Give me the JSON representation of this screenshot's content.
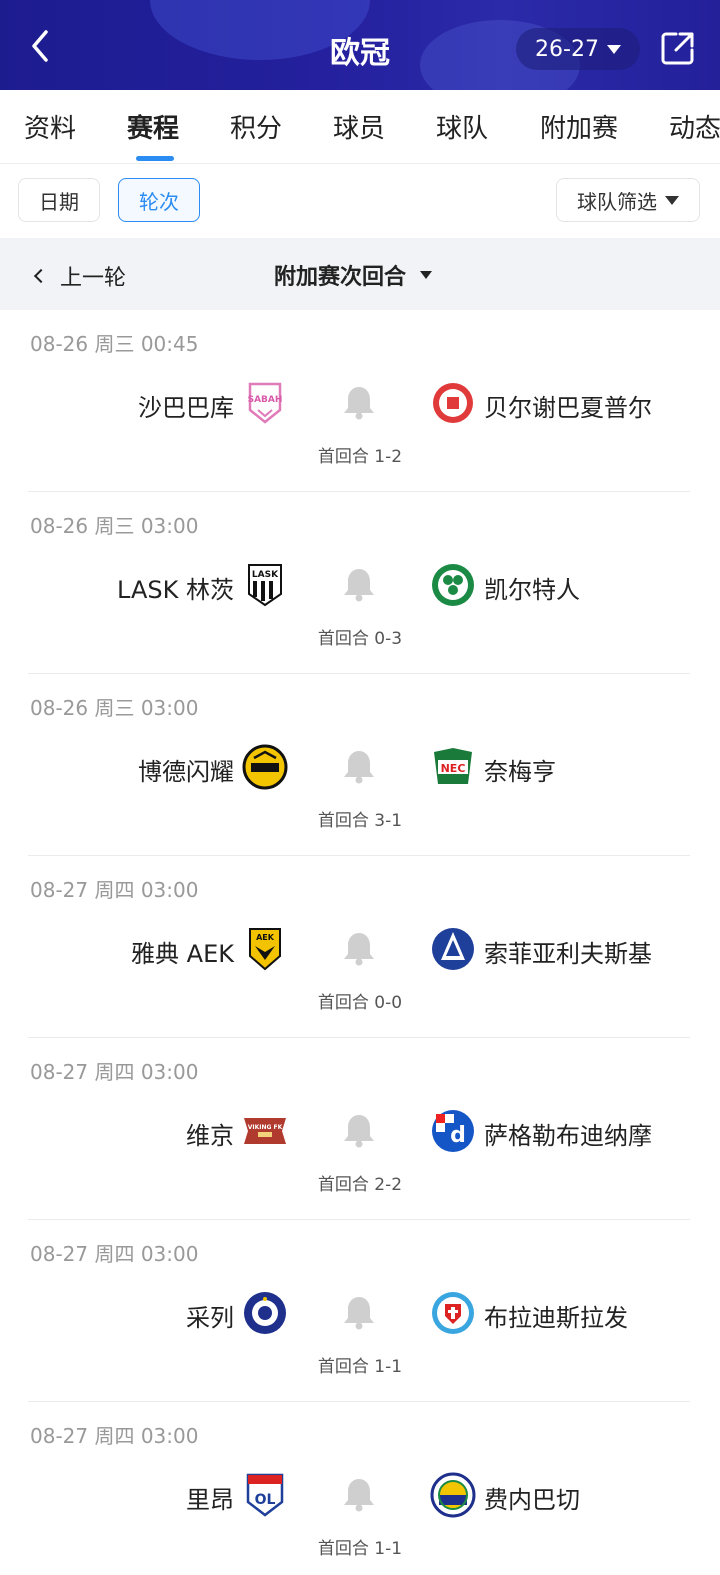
{
  "header": {
    "title": "欧冠",
    "season": "26-27"
  },
  "tabs": [
    "资料",
    "赛程",
    "积分",
    "球员",
    "球队",
    "附加赛",
    "动态"
  ],
  "filters": {
    "date": "日期",
    "round": "轮次",
    "team": "球队筛选"
  },
  "roundbar": {
    "prev": "上一轮",
    "title": "附加赛次回合"
  },
  "matches": [
    {
      "time": "08-26 周三 00:45",
      "home": "沙巴巴库",
      "away": "贝尔谢巴夏普尔",
      "agg": "首回合 1-2",
      "home_logo_text": "SABAH",
      "away_logo_text": ""
    },
    {
      "time": "08-26 周三 03:00",
      "home": "LASK 林茨",
      "away": "凯尔特人",
      "agg": "首回合 0-3",
      "home_logo_text": "LASK",
      "away_logo_text": ""
    },
    {
      "time": "08-26 周三 03:00",
      "home": "博德闪耀",
      "away": "奈梅亨",
      "agg": "首回合 3-1",
      "home_logo_text": "",
      "away_logo_text": "NEC"
    },
    {
      "time": "08-27 周四 03:00",
      "home": "雅典 AEK",
      "away": "索菲亚利夫斯基",
      "agg": "首回合 0-0",
      "home_logo_text": "AEK",
      "away_logo_text": ""
    },
    {
      "time": "08-27 周四 03:00",
      "home": "维京",
      "away": "萨格勒布迪纳摩",
      "agg": "首回合 2-2",
      "home_logo_text": "VIKING FK",
      "away_logo_text": "d"
    },
    {
      "time": "08-27 周四 03:00",
      "home": "采列",
      "away": "布拉迪斯拉发",
      "agg": "首回合 1-1",
      "home_logo_text": "",
      "away_logo_text": ""
    },
    {
      "time": "08-27 周四 03:00",
      "home": "里昂",
      "away": "费内巴切",
      "agg": "首回合 1-1",
      "home_logo_text": "OL",
      "away_logo_text": ""
    }
  ],
  "colors": {
    "accent": "#2b8cf2",
    "header": "#23209a"
  }
}
